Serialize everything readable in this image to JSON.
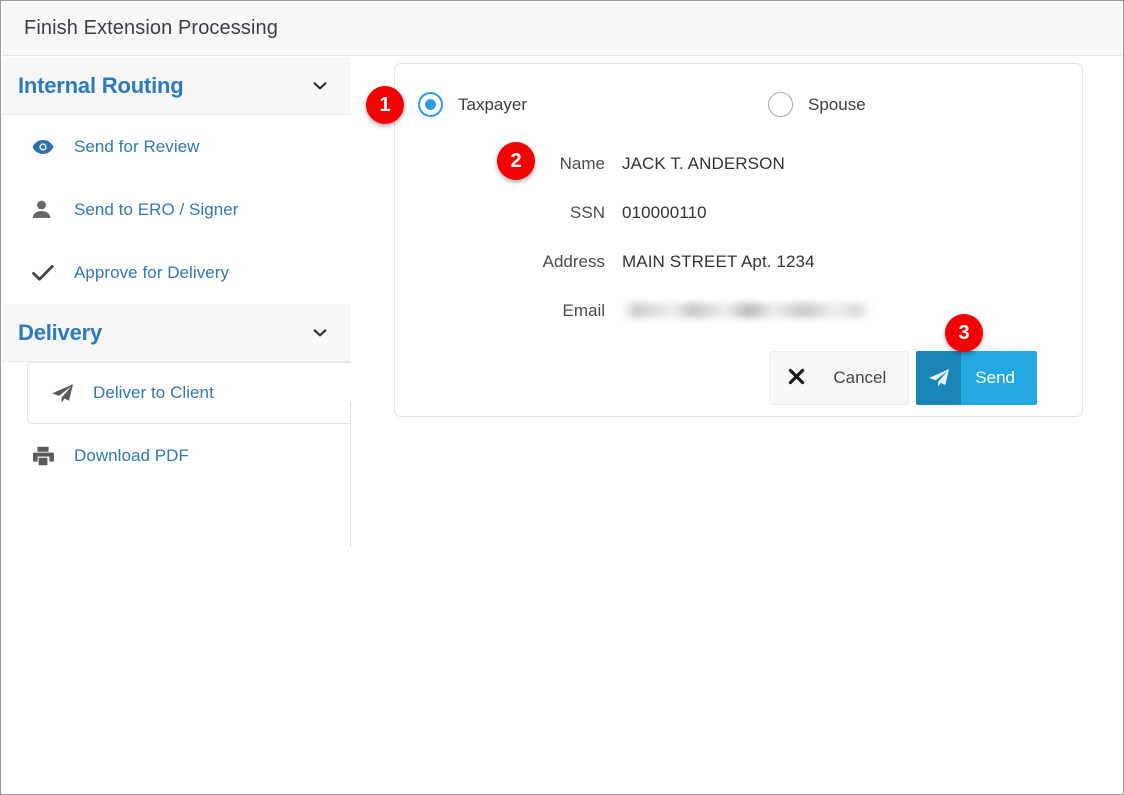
{
  "window": {
    "title": "Finish Extension Processing"
  },
  "sidebar": {
    "sections": [
      {
        "title": "Internal Routing",
        "chevron_icon": "chevron-down-icon",
        "items": [
          {
            "label": "Send for Review",
            "icon": "eye-icon",
            "active": false
          },
          {
            "label": "Send to ERO / Signer",
            "icon": "person-icon",
            "active": false
          },
          {
            "label": "Approve for Delivery",
            "icon": "check-icon",
            "active": false
          }
        ]
      },
      {
        "title": "Delivery",
        "chevron_icon": "chevron-down-icon",
        "items": [
          {
            "label": "Deliver to Client",
            "icon": "paper-plane-icon",
            "active": true
          },
          {
            "label": "Download PDF",
            "icon": "printer-icon",
            "active": false
          }
        ]
      }
    ]
  },
  "main": {
    "recipient": {
      "options": [
        {
          "label": "Taxpayer",
          "selected": true
        },
        {
          "label": "Spouse",
          "selected": false
        }
      ]
    },
    "fields": [
      {
        "label": "Name",
        "value": "JACK T. ANDERSON",
        "redacted": false
      },
      {
        "label": "SSN",
        "value": "010000110",
        "redacted": false
      },
      {
        "label": "Address",
        "value": "MAIN STREET Apt. 1234",
        "redacted": false
      },
      {
        "label": "Email",
        "value": "",
        "redacted": true
      }
    ],
    "buttons": {
      "cancel_label": "Cancel",
      "cancel_icon": "close-x-icon",
      "send_label": "Send",
      "send_icon": "paper-plane-icon"
    }
  },
  "step_badges": [
    {
      "number": "1"
    },
    {
      "number": "2"
    },
    {
      "number": "3"
    }
  ],
  "colors": {
    "accent_blue": "#3178b5",
    "header_blue": "#2a7ac0",
    "radio_blue": "#2f9de0",
    "send_light": "#23a8e1",
    "send_dark": "#1b85b7",
    "badge_red": "#f30000"
  }
}
